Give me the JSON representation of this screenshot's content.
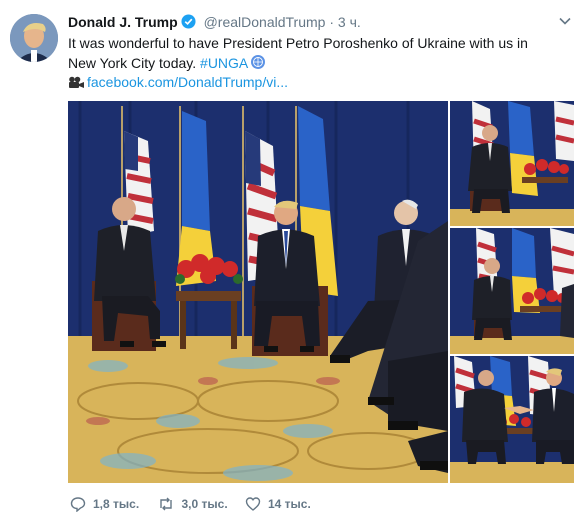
{
  "tweet": {
    "name": "Donald J. Trump",
    "handle": "@realDonaldTrump",
    "separator": "·",
    "time": "3 ч.",
    "text": "It was wonderful to have President Petro Poroshenko of Ukraine with us in New York City today. ",
    "hashtag": "#UNGA",
    "link": "facebook.com/DonaldTrump/vi..."
  },
  "actions": {
    "reply_count": "1,8 тыс.",
    "retweet_count": "3,0 тыс.",
    "like_count": "14 тыс."
  },
  "colors": {
    "link": "#1b95e0",
    "verified": "#1da1f2",
    "muted": "#657786",
    "curtain": "#1c2f6e",
    "carpet": "#d8b45a"
  },
  "icons": [
    "verified-icon",
    "chevron-down-icon",
    "video-camera-icon",
    "un-globe-icon",
    "reply-icon",
    "retweet-icon",
    "like-icon"
  ]
}
